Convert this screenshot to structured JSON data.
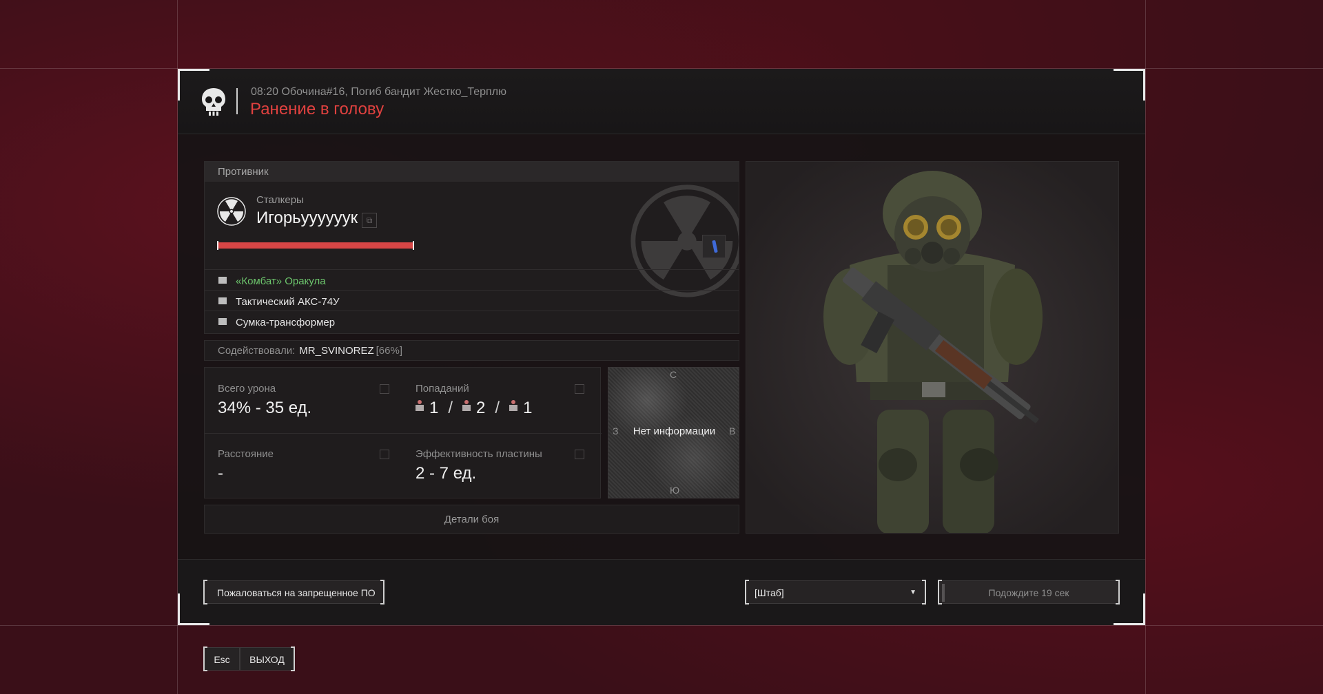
{
  "header": {
    "event_line": "08:20 Обочина#16, Погиб бандит Жестко_Терплю",
    "death_cause": "Ранение в голову"
  },
  "enemy": {
    "section_title": "Противник",
    "faction": "Сталкеры",
    "name": "Игорьуууууук",
    "health_fraction": 1.0,
    "equipment": [
      {
        "label": "«Комбат» Оракула",
        "color": "#6dc66d",
        "icon": "armor-icon"
      },
      {
        "label": "Тактический АКС-74У",
        "color": "#e4e4e4",
        "icon": "rifle-icon"
      },
      {
        "label": "Сумка-трансформер",
        "color": "#e4e4e4",
        "icon": "bag-icon"
      }
    ]
  },
  "assist": {
    "label": "Содействовали:",
    "player": "MR_SVINOREZ",
    "percent": "[66%]"
  },
  "stats": {
    "total_damage": {
      "label": "Всего урона",
      "value": "34% - 35 ед."
    },
    "hits": {
      "label": "Попаданий",
      "head": "1",
      "body": "2",
      "legs": "1"
    },
    "distance": {
      "label": "Расстояние",
      "value": "-"
    },
    "plate_efficiency": {
      "label": "Эффективность пластины",
      "value": "2 - 7 ед."
    }
  },
  "minimap": {
    "north": "С",
    "south": "Ю",
    "west": "З",
    "east": "В",
    "message": "Нет информации"
  },
  "details_button": "Детали боя",
  "footer": {
    "report_button": "Пожаловаться на запрещенное ПО",
    "respawn_select": "[Штаб]",
    "wait_button": "Подождите 19 сек",
    "esc_key": "Esc",
    "exit_button": "ВЫХОД"
  },
  "colors": {
    "accent_red": "#e0413f",
    "health_bar": "#d64646",
    "equipment_rare": "#6dc66d"
  }
}
